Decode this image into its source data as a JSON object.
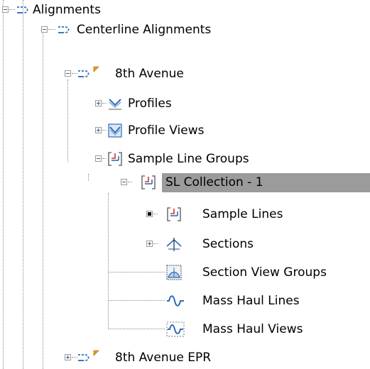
{
  "tree": {
    "alignments": {
      "label": "Alignments",
      "icon": "alignment-icon"
    },
    "centerline": {
      "label": "Centerline Alignments",
      "icon": "alignment-icon"
    },
    "eighth": {
      "label": "8th Avenue",
      "icon": "alignment-flag-icon"
    },
    "profiles": {
      "label": "Profiles",
      "icon": "profile-icon"
    },
    "profile_views": {
      "label": "Profile Views",
      "icon": "profile-view-icon"
    },
    "sample_line_groups": {
      "label": "Sample Line Groups",
      "icon": "sample-line-group-icon"
    },
    "sl_collection": {
      "label": "SL Collection - 1",
      "icon": "sample-line-group-icon",
      "selected": true
    },
    "sample_lines": {
      "label": "Sample Lines",
      "icon": "sample-line-icon"
    },
    "sections": {
      "label": "Sections",
      "icon": "section-icon"
    },
    "section_view_groups": {
      "label": "Section View Groups",
      "icon": "section-view-icon"
    },
    "mass_haul_lines": {
      "label": "Mass Haul Lines",
      "icon": "mass-haul-icon"
    },
    "mass_haul_views": {
      "label": "Mass Haul Views",
      "icon": "mass-haul-view-icon"
    },
    "eighth_epr": {
      "label": "8th Avenue EPR",
      "icon": "alignment-flag-icon"
    }
  },
  "colors": {
    "selection": "#9b9b9b",
    "icon_blue": "#2f6db5",
    "icon_red": "#d03030",
    "flag": "#e8a000"
  }
}
